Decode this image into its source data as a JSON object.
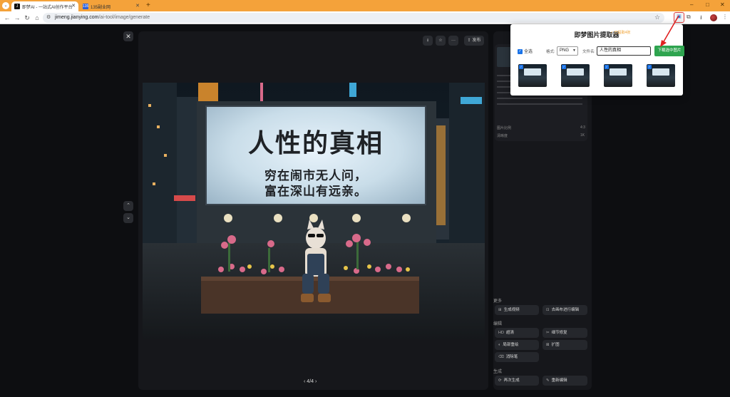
{
  "browser": {
    "tabs": [
      {
        "label": "即梦AI - 一站式AI创作平台",
        "favicon": "J",
        "active": true
      },
      {
        "label": "135副业网",
        "favicon": "135",
        "active": false
      }
    ],
    "new_tab_glyph": "+",
    "window_controls": {
      "minimize": "–",
      "maximize": "□",
      "close": "✕"
    },
    "url_host": "jimeng.jianying.com",
    "url_path": "/ai-tool/image/generate",
    "site_info_icon": "tune-icon",
    "bookmark_icon": "star-icon",
    "extension_icon": "image-extractor-icon",
    "accent_color": "#f4a23a"
  },
  "viewer": {
    "close_glyph": "✕",
    "toolbar": {
      "download_glyph": "⭳",
      "favorite_glyph": "☆",
      "more_glyph": "···",
      "publish_label": "发布"
    },
    "page_indicator": "4/4",
    "prev_glyph": "‹",
    "next_glyph": "›",
    "up_glyph": "⌃",
    "down_glyph": "⌄"
  },
  "scene": {
    "billboard_title": "人性的真相",
    "billboard_line1": "穷在闹市无人问，",
    "billboard_line2": "富在深山有远亲。"
  },
  "right_panel": {
    "info": {
      "rows": [
        {
          "label": "图片比例",
          "value": "4:3"
        },
        {
          "label": "清晰度",
          "value": "1K"
        }
      ]
    },
    "more_title": "更多",
    "more_buttons": [
      {
        "label": "生成视频",
        "icon": "video-icon"
      },
      {
        "label": "去画布进行编辑",
        "icon": "canvas-icon"
      }
    ],
    "edit_title": "编辑",
    "edit_buttons": [
      {
        "label": "超清",
        "icon": "hd-icon"
      },
      {
        "label": "细节修复",
        "icon": "repair-icon"
      },
      {
        "label": "局部重绘",
        "icon": "brush-icon"
      },
      {
        "label": "扩图",
        "icon": "expand-icon"
      },
      {
        "label": "消除笔",
        "icon": "eraser-icon"
      }
    ],
    "generate_title": "生成",
    "generate_buttons": [
      {
        "label": "再次生成",
        "icon": "refresh-icon"
      },
      {
        "label": "重新编辑",
        "icon": "edit-icon"
      }
    ]
  },
  "popup": {
    "title": "即梦图片提取器",
    "count_badge": "✓ 已提取4张",
    "select_all_label": "全选",
    "format_label": "格式:",
    "format_value": "PNG",
    "filename_label": "文件名:",
    "filename_value": "人性的真相",
    "download_button": "下载选中图片",
    "thumbnails": [
      {
        "selected": true
      },
      {
        "selected": true
      },
      {
        "selected": true
      },
      {
        "selected": true
      }
    ]
  }
}
